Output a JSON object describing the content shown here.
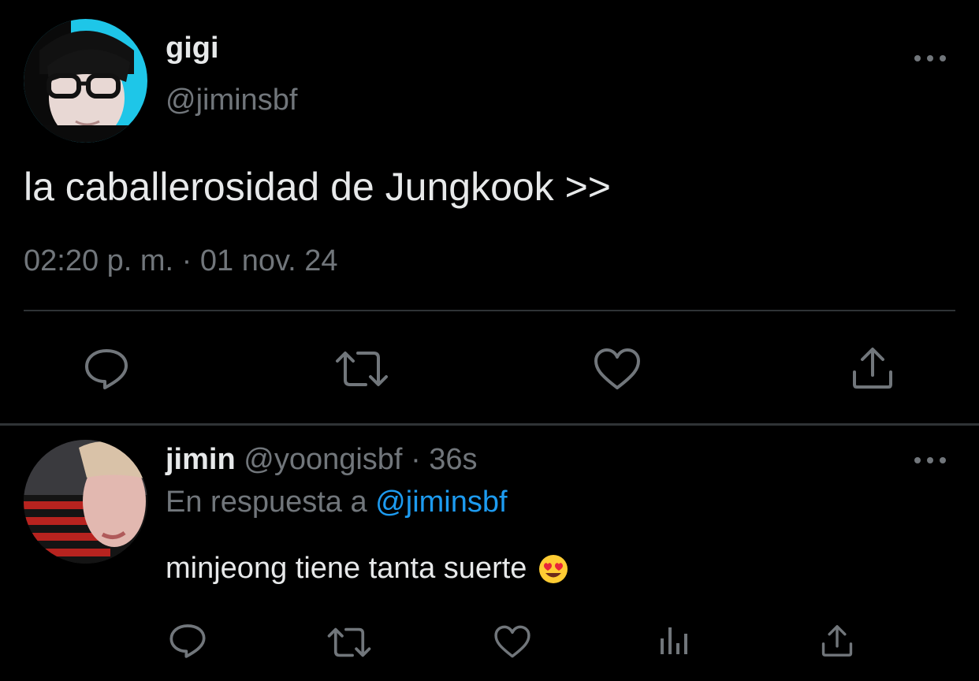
{
  "tweet": {
    "author": {
      "display_name": "gigi",
      "handle": "@jiminsbf",
      "avatar": "avatar-glasses-person"
    },
    "text": "la caballerosidad de Jungkook >>",
    "timestamp": "02:20 p. m. · 01 nov. 24",
    "actions": [
      "reply-icon",
      "retweet-icon",
      "like-icon",
      "share-icon"
    ],
    "more_icon": "more-horizontal-icon"
  },
  "reply": {
    "author": {
      "display_name": "jimin",
      "handle": "@yoongisbf",
      "avatar": "avatar-striped-shirt-person"
    },
    "separator": "·",
    "age": "36s",
    "reply_to_prefix": "En respuesta a",
    "reply_to_handle": "@jiminsbf",
    "text": "minjeong tiene tanta suerte",
    "emoji": "heart-eyes-emoji",
    "actions": [
      "reply-icon",
      "retweet-icon",
      "like-icon",
      "analytics-icon",
      "share-icon"
    ],
    "more_icon": "more-horizontal-icon"
  },
  "colors": {
    "background": "#000000",
    "primary_text": "#e7e9ea",
    "secondary_text": "#71767b",
    "link": "#1d9bf0",
    "divider": "#2f3336"
  }
}
